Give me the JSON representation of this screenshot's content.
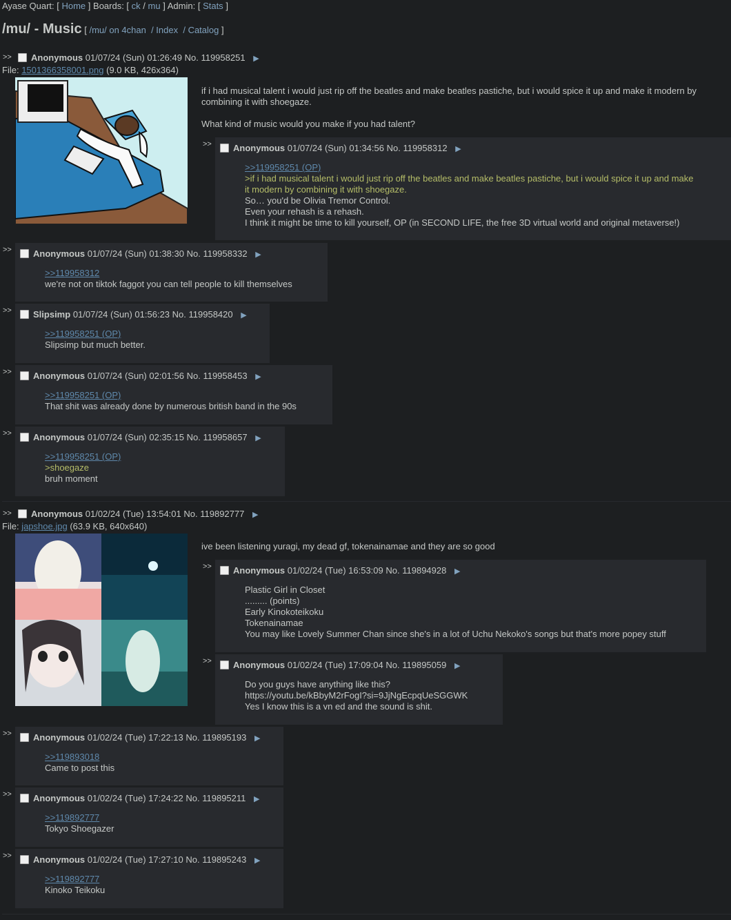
{
  "topbar": {
    "prefix": "Ayase Quart: [",
    "home": "Home",
    "boards_prefix": "] Boards: [",
    "board_ck": "ck",
    "sep": "/",
    "board_mu": "mu",
    "admin_prefix": "] Admin: [",
    "stats": "Stats",
    "suffix": "]"
  },
  "board": {
    "title": "/mu/ - Music",
    "nav_open": "[",
    "on4chan": "/mu/ on 4chan",
    "index": "/ Index",
    "catalog": "/ Catalog",
    "nav_close": "]"
  },
  "side_arrows": ">>",
  "post_arrow": "▶",
  "threads": [
    {
      "op": {
        "name": "Anonymous",
        "datetime": "01/07/24 (Sun) 01:26:49",
        "no": "No. 119958251",
        "file_label": "File:",
        "file_name": "1501366358001.png",
        "file_meta": "(9.0 KB, 426x364)",
        "body": [
          "if i had musical talent i would just rip off the beatles and make beatles pastiche, but i would spice it up and make it modern by",
          "combining it with shoegaze.",
          "",
          "What kind of music would you make if you had talent?"
        ]
      },
      "replies": [
        {
          "name": "Anonymous",
          "datetime": "01/07/24 (Sun) 01:34:56",
          "no": "No. 119958312",
          "lines": [
            {
              "t": ">>119958251 (OP)",
              "k": "ql"
            },
            {
              "t": ">if i had musical talent i would just rip off the beatles and make beatles pastiche, but i would spice it up and make",
              "k": "q"
            },
            {
              "t": "it modern by combining it with shoegaze.",
              "k": "q"
            },
            {
              "t": "So… you'd be Olivia Tremor Control.",
              "k": "n"
            },
            {
              "t": "Even your rehash is a rehash.",
              "k": "n"
            },
            {
              "t": "I think it might be time to kill yourself, OP (in SECOND LIFE, the free 3D virtual world and original metaverse!)",
              "k": "n"
            }
          ]
        },
        {
          "name": "Anonymous",
          "datetime": "01/07/24 (Sun) 01:38:30",
          "no": "No. 119958332",
          "lines": [
            {
              "t": ">>119958312",
              "k": "ql"
            },
            {
              "t": "we're not on tiktok faggot you can tell people to kill themselves",
              "k": "n"
            }
          ]
        },
        {
          "name": "Slipsimp",
          "datetime": "01/07/24 (Sun) 01:56:23",
          "no": "No. 119958420",
          "lines": [
            {
              "t": ">>119958251 (OP)",
              "k": "ql"
            },
            {
              "t": "Slipsimp but much better.",
              "k": "n"
            }
          ]
        },
        {
          "name": "Anonymous",
          "datetime": "01/07/24 (Sun) 02:01:56",
          "no": "No. 119958453",
          "lines": [
            {
              "t": ">>119958251 (OP)",
              "k": "ql"
            },
            {
              "t": "That shit was already done by numerous british band in the 90s",
              "k": "n"
            }
          ]
        },
        {
          "name": "Anonymous",
          "datetime": "01/07/24 (Sun) 02:35:15",
          "no": "No. 119958657",
          "lines": [
            {
              "t": ">>119958251 (OP)",
              "k": "ql"
            },
            {
              "t": ">shoegaze",
              "k": "q"
            },
            {
              "t": "bruh moment",
              "k": "n"
            }
          ]
        }
      ]
    },
    {
      "op": {
        "name": "Anonymous",
        "datetime": "01/02/24 (Tue) 13:54:01",
        "no": "No. 119892777",
        "file_label": "File:",
        "file_name": "japshoe.jpg",
        "file_meta": "(63.9 KB, 640x640)",
        "body": [
          "ive been listening yuragi, my dead gf, tokenainamae and they are so good"
        ]
      },
      "replies": [
        {
          "name": "Anonymous",
          "datetime": "01/02/24 (Tue) 16:53:09",
          "no": "No. 119894928",
          "lines": [
            {
              "t": "Plastic Girl in Closet",
              "k": "n"
            },
            {
              "t": "......... (points)",
              "k": "n"
            },
            {
              "t": "Early Kinokoteikoku",
              "k": "n"
            },
            {
              "t": "Tokenainamae",
              "k": "n"
            },
            {
              "t": "You may like Lovely Summer Chan since she's in a lot of Uchu Nekoko's songs but that's more popey stuff",
              "k": "n"
            }
          ]
        },
        {
          "name": "Anonymous",
          "datetime": "01/02/24 (Tue) 17:09:04",
          "no": "No. 119895059",
          "lines": [
            {
              "t": "Do you guys have anything like this?",
              "k": "n"
            },
            {
              "t": "https://youtu.be/kBbyM2rFogI?si=9JjNgEcpqUeSGGWK",
              "k": "n"
            },
            {
              "t": "Yes I know this is a vn ed and the sound is shit.",
              "k": "n"
            }
          ]
        },
        {
          "name": "Anonymous",
          "datetime": "01/02/24 (Tue) 17:22:13",
          "no": "No. 119895193",
          "lines": [
            {
              "t": ">>119893018",
              "k": "ql"
            },
            {
              "t": "Came to post this",
              "k": "n"
            }
          ]
        },
        {
          "name": "Anonymous",
          "datetime": "01/02/24 (Tue) 17:24:22",
          "no": "No. 119895211",
          "lines": [
            {
              "t": ">>119892777",
              "k": "ql"
            },
            {
              "t": "Tokyo Shoegazer",
              "k": "n"
            }
          ]
        },
        {
          "name": "Anonymous",
          "datetime": "01/02/24 (Tue) 17:27:10",
          "no": "No. 119895243",
          "lines": [
            {
              "t": ">>119892777",
              "k": "ql"
            },
            {
              "t": "Kinoko Teikoku",
              "k": "n"
            }
          ]
        }
      ]
    }
  ]
}
